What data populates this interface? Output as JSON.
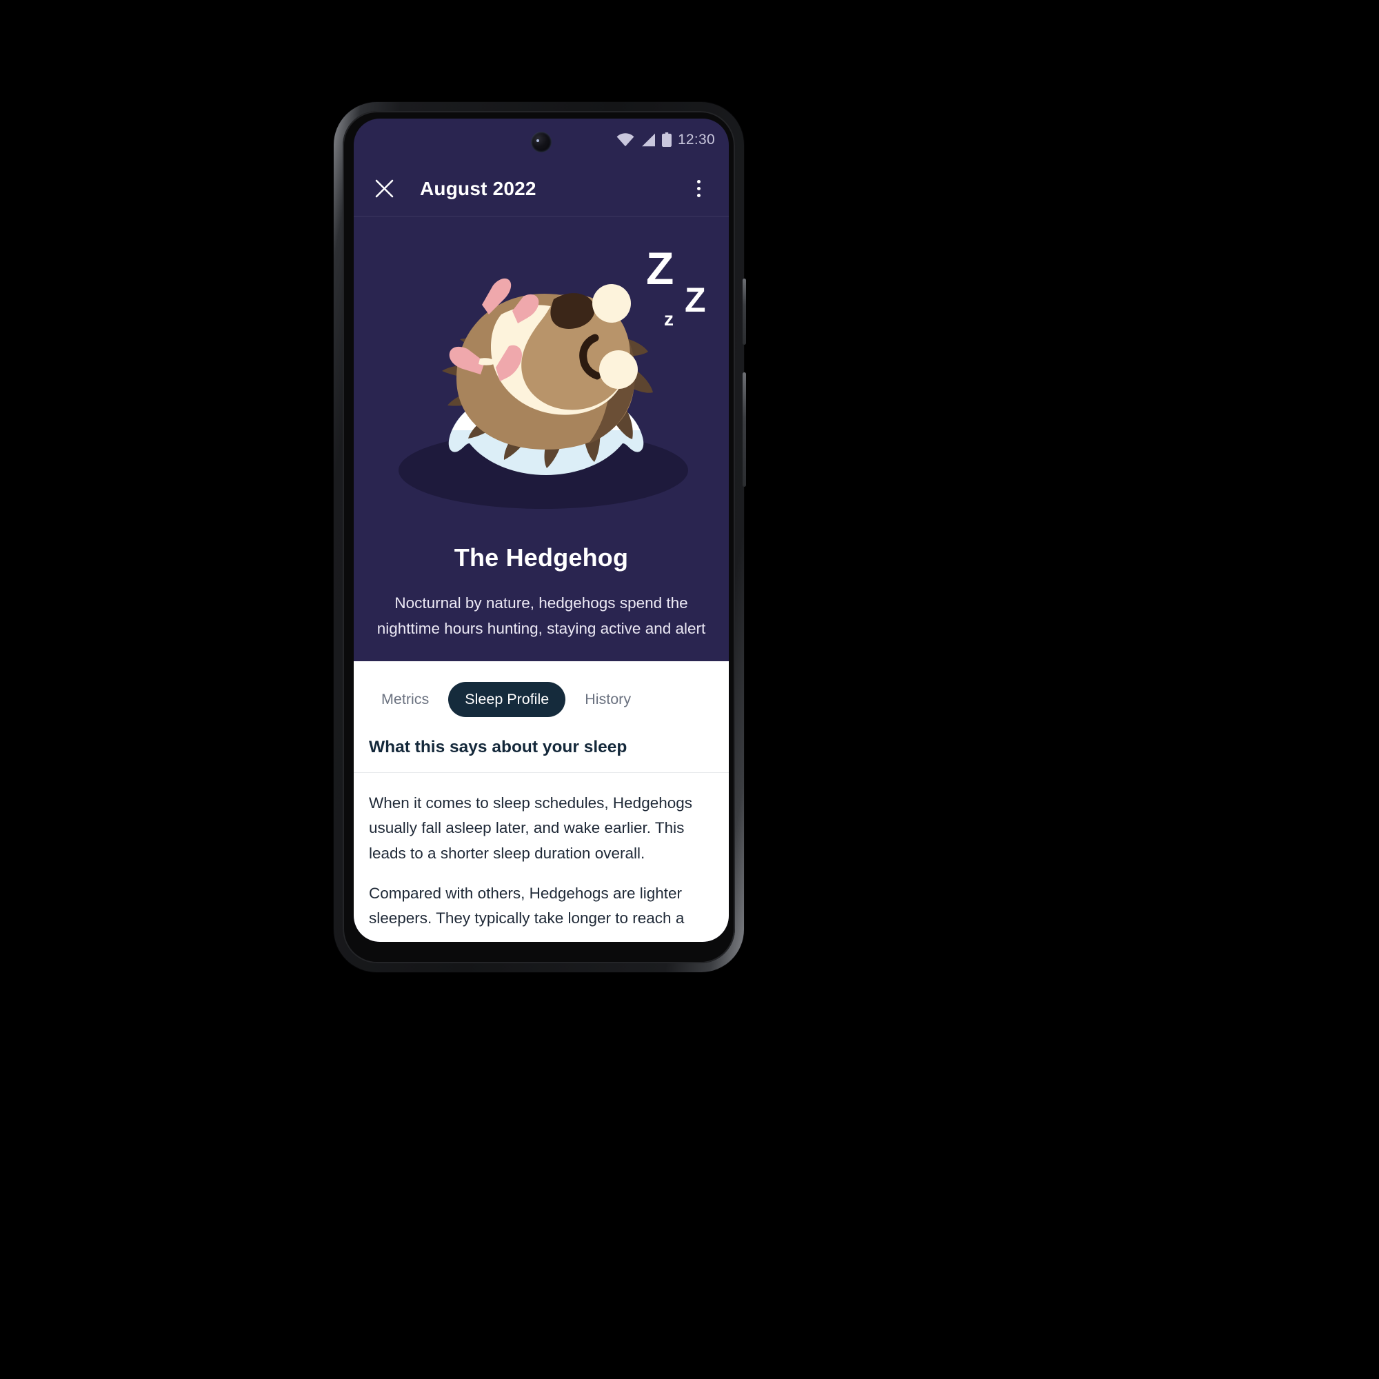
{
  "device": {
    "status_bar": {
      "wifi_icon": "wifi-icon",
      "cellular_icon": "cellular-signal-icon",
      "battery_icon": "battery-icon",
      "time": "12:30"
    },
    "home_indicator": "home-indicator"
  },
  "app_bar": {
    "close_icon": "close-icon",
    "title": "August 2022",
    "overflow_icon": "overflow-menu-icon"
  },
  "hero": {
    "illustration_name": "sleeping-hedgehog-illustration",
    "sleep_marks": [
      "Z",
      "Z",
      "z"
    ],
    "title": "The Hedgehog",
    "description": "Nocturnal by nature, hedgehogs spend the nighttime hours hunting, staying active and alert"
  },
  "tabs": [
    {
      "label": "Metrics",
      "active": false
    },
    {
      "label": "Sleep Profile",
      "active": true
    },
    {
      "label": "History",
      "active": false
    }
  ],
  "section": {
    "heading": "What this says about your sleep",
    "paragraphs": [
      "When it comes to sleep schedules, Hedgehogs usually fall asleep later, and wake earlier. This leads to a shorter sleep duration overall.",
      "Compared with others, Hedgehogs are lighter sleepers. They typically take longer to reach a"
    ]
  },
  "colors": {
    "hero_background": "#2A2550",
    "illustration_shadow": "#1E1A3C",
    "active_tab_background": "#152B3C",
    "sheet_background": "#FFFFFF",
    "heading_text": "#14283A",
    "inactive_tab_text": "#6B7280",
    "hedgehog_quills": "#5D4530",
    "hedgehog_body": "#A8845C",
    "hedgehog_belly": "#FDF3DC",
    "hedgehog_paws": "#EFA8AC",
    "pillow_top": "#FFFFFF",
    "pillow_bottom": "#DCEEF7"
  }
}
